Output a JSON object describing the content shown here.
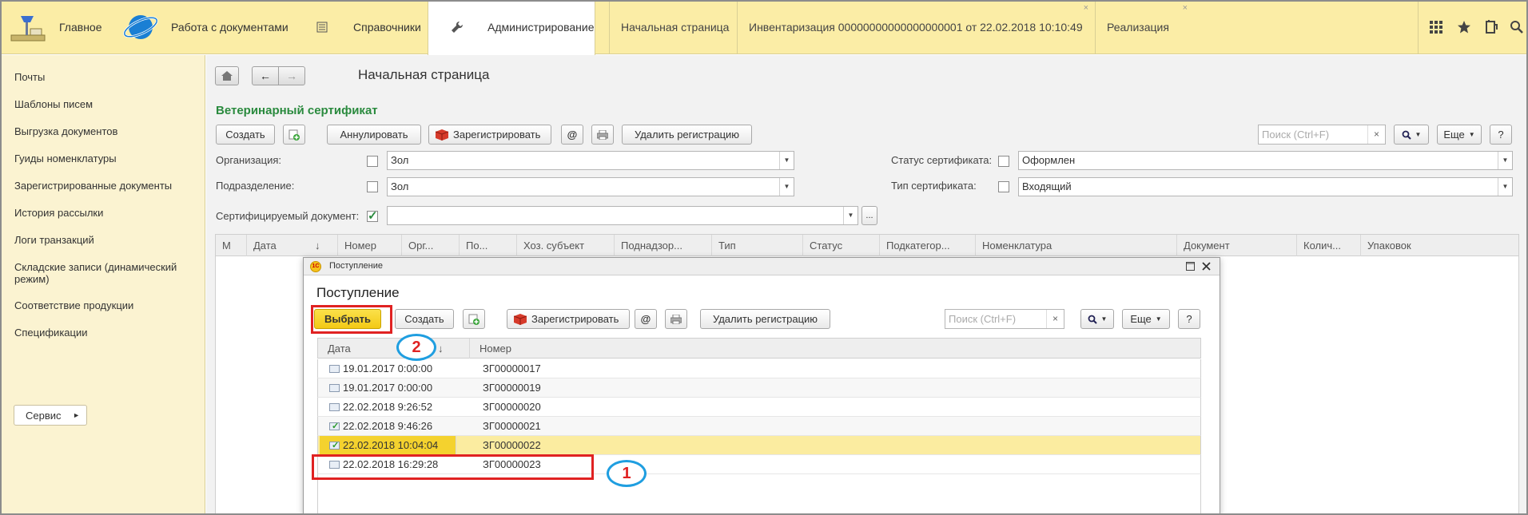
{
  "topbar": {
    "sections": [
      {
        "label": "Главное",
        "icon": "desk-lamp-icon"
      },
      {
        "label": "Работа с документами",
        "icon": "globe-ring-icon"
      },
      {
        "label": "Справочники",
        "icon": "list-icon"
      },
      {
        "label": "Администрирование",
        "icon": "wrench-icon"
      }
    ],
    "open_tabs": [
      {
        "label": "Начальная страница",
        "closable": false
      },
      {
        "label": "Инвентаризация 00000000000000000001 от 22.02.2018 10:10:49",
        "closable": true
      },
      {
        "label": "Реализация",
        "closable": true
      }
    ],
    "close_glyph": "×",
    "right_icons": [
      "apps-grid-icon",
      "favorites-star-icon",
      "history-icon",
      "search-icon"
    ]
  },
  "sidebar": {
    "items": [
      "Почты",
      "Шаблоны писем",
      "Выгрузка документов",
      "Гуиды номенклатуры",
      "Зарегистрированные документы",
      "История рассылки",
      "Логи транзакций",
      "Складские записи (динамический режим)",
      "Соответствие продукции",
      "Спецификации"
    ],
    "service_button": "Сервис"
  },
  "main": {
    "page_title": "Начальная страница",
    "section_title": "Ветеринарный сертификат",
    "toolbar": {
      "create": "Создать",
      "annul": "Аннулировать",
      "register": "Зарегистрировать",
      "email": "@",
      "delete_registration": "Удалить регистрацию",
      "search_placeholder": "Поиск (Ctrl+F)",
      "search_clear": "×",
      "more": "Еще",
      "help": "?"
    },
    "filters": {
      "organization_label": "Организация:",
      "organization_value": "Зол",
      "subdivision_label": "Подразделение:",
      "subdivision_value": "Зол",
      "certified_doc_label": "Сертифицируемый документ:",
      "certified_doc_value": "",
      "status_label": "Статус сертификата:",
      "status_value": "Оформлен",
      "type_label": "Тип сертификата:",
      "type_value": "Входящий",
      "ellipsis": "..."
    },
    "table_columns": [
      "М",
      "Дата",
      "↓",
      "Номер",
      "Орг...",
      "По...",
      "Хоз. субъект",
      "Поднадзор...",
      "Тип",
      "Статус",
      "Подкатегор...",
      "Номенклатура",
      "Документ",
      "Колич...",
      "Упаковок"
    ]
  },
  "modal": {
    "window_title": "Поступление",
    "title": "Поступление",
    "logo_text": "1С",
    "toolbar": {
      "select": "Выбрать",
      "create": "Создать",
      "register": "Зарегистрировать",
      "email": "@",
      "delete_registration": "Удалить регистрацию",
      "search_placeholder": "Поиск (Ctrl+F)",
      "search_clear": "×",
      "more": "Еще",
      "help": "?"
    },
    "columns": {
      "date": "Дата",
      "sort": "↓",
      "number": "Номер"
    },
    "rows": [
      {
        "date": "19.01.2017 0:00:00",
        "number": "ЗГ00000017",
        "posted": false
      },
      {
        "date": "19.01.2017 0:00:00",
        "number": "ЗГ00000019",
        "posted": false
      },
      {
        "date": "22.02.2018 9:26:52",
        "number": "ЗГ00000020",
        "posted": false
      },
      {
        "date": "22.02.2018 9:46:26",
        "number": "ЗГ00000021",
        "posted": true
      },
      {
        "date": "22.02.2018 10:04:04",
        "number": "ЗГ00000022",
        "posted": true,
        "selected": true
      },
      {
        "date": "22.02.2018 16:29:28",
        "number": "ЗГ00000023",
        "posted": false
      }
    ]
  },
  "annotations": {
    "step1": "1",
    "step2": "2"
  },
  "colors": {
    "accent_yellow": "#fbeda6",
    "section_green": "#2a8a3e",
    "select_button": "#f3c915",
    "highlight_red": "#e02222",
    "bubble_blue": "#1f9ee0"
  }
}
